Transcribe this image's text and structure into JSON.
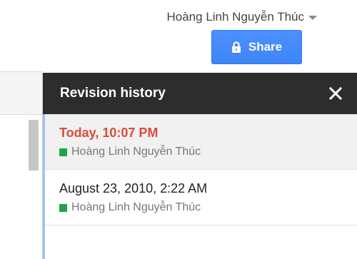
{
  "header": {
    "user_name": "Hoàng Linh Nguyễn Thúc",
    "share_label": "Share"
  },
  "revision_panel": {
    "title": "Revision history",
    "items": [
      {
        "date": "Today, 10:07 PM",
        "author": "Hoàng Linh Nguyễn Thúc",
        "selected": true
      },
      {
        "date": "August 23, 2010, 2:22 AM",
        "author": "Hoàng Linh Nguyễn Thúc",
        "selected": false
      }
    ]
  },
  "colors": {
    "accent_blue": "#4d90fe",
    "selected_date_red": "#dd4b39",
    "author_green": "#1fa44e",
    "panel_header_bg": "#2d2d2d"
  },
  "icons": {
    "dropdown": "chevron-down-icon",
    "lock": "lock-icon",
    "close": "close-icon"
  }
}
